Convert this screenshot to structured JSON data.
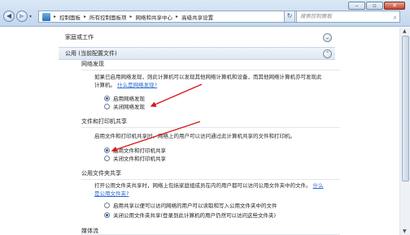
{
  "window": {
    "minimize_label": "–",
    "maximize_label": "▫",
    "close_label": "✕"
  },
  "nav": {
    "back_label": "◀",
    "forward_label": "▶",
    "dropdown_label": "▾"
  },
  "address": {
    "crumbs": [
      "控制面板",
      "所有控制面板项",
      "网络和共享中心",
      "高级共享设置"
    ],
    "separator": "▸",
    "dropdown_label": "▾",
    "refresh_label": "↻"
  },
  "search": {
    "placeholder": "搜索控制面板",
    "icon_label": "⌕"
  },
  "profiles": {
    "home": {
      "label": "家庭或工作",
      "toggle": "⌄"
    },
    "current": {
      "label": "公用 (当前配置文件)",
      "toggle": "⌃"
    }
  },
  "network_discovery": {
    "title": "网络发现",
    "description": "如果已启用网络发现，则此计算机可以发现其他网络计算机和设备，而其他网络计算机亦可发现此计算机。",
    "link": "什么是网络发现?",
    "options": [
      {
        "label": "启用网络发现",
        "selected": true
      },
      {
        "label": "关闭网络发现",
        "selected": false
      }
    ]
  },
  "file_printer_sharing": {
    "title": "文件和打印机共享",
    "description": "启用文件和打印机共享时，网络上的用户可以访问通过此计算机共享的文件和打印机。",
    "options": [
      {
        "label": "启用文件和打印机共享",
        "selected": true
      },
      {
        "label": "关闭文件和打印机共享",
        "selected": false
      }
    ]
  },
  "public_folder_sharing": {
    "title": "公用文件夹共享",
    "description": "打开公用文件夹共享时，网络上包括家庭组成员在内的用户都可以访问公用文件夹中的文件。",
    "link": "什么是公用文件夹?",
    "options": [
      {
        "label": "启用共享以便可以访问网络的用户可以读取和写入公用文件夹中的文件",
        "selected": false
      },
      {
        "label": "关闭公用文件夹共享(登录到此计算机的用户仍然可以访问这些文件夹)",
        "selected": true
      }
    ]
  },
  "media_streaming": {
    "title": "媒体流"
  },
  "annotation_color": "#d7191c"
}
